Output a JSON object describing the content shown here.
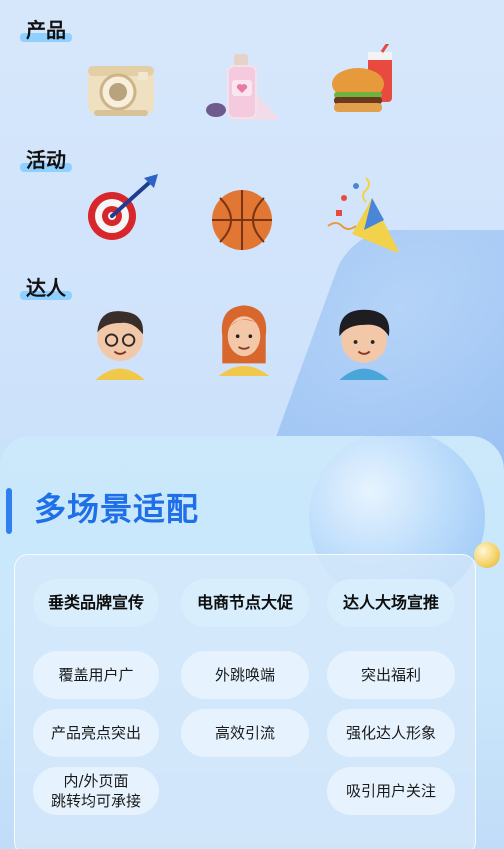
{
  "categories": [
    {
      "label": "产品",
      "icons": [
        "camera-icon",
        "perfume-bottle-icon",
        "burger-drink-icon"
      ]
    },
    {
      "label": "活动",
      "icons": [
        "dart-target-icon",
        "basketball-icon",
        "party-popper-icon"
      ]
    },
    {
      "label": "达人",
      "icons": [
        "boy-glasses-avatar-icon",
        "girl-red-hair-avatar-icon",
        "boy-black-hair-avatar-icon"
      ]
    }
  ],
  "section": {
    "title": "多场景适配"
  },
  "primary_chips": [
    "垂类品牌宣传",
    "电商节点大促",
    "达人大场宣推"
  ],
  "chips": {
    "row2": [
      "覆盖用户广",
      "外跳唤端",
      "突出福利"
    ],
    "row3": [
      "产品亮点突出",
      "高效引流",
      "强化达人形象"
    ],
    "row4_left_line1": "内/外页面",
    "row4_left_line2": "跳转均可承接",
    "row4_right": "吸引用户关注"
  },
  "colors": {
    "accent": "#1f6fe8",
    "label_highlight": "#8fd0ff"
  }
}
